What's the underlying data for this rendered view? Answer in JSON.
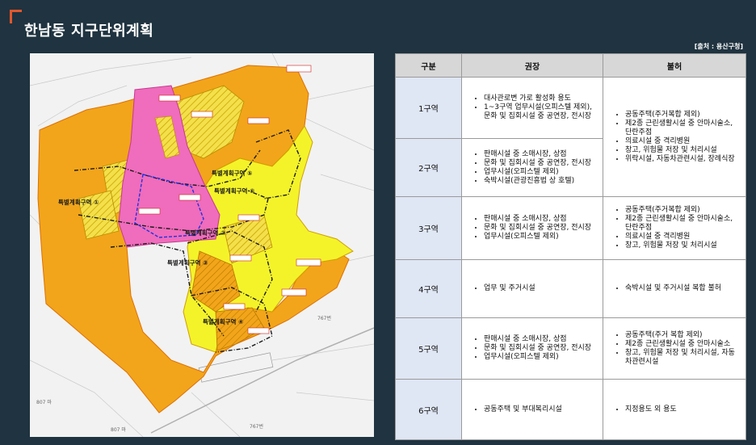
{
  "header": {
    "title": "한남동 지구단위계획",
    "source": "[출처 : 용산구청]"
  },
  "map": {
    "district_labels": [
      "특별계획구역 ①",
      "특별계획구역 ②",
      "특별계획구역 ③",
      "특별계획구역 ④",
      "특별계획구역 ⑤",
      "특별계획구역 ⑥"
    ],
    "road_labels": [
      "767번",
      "767번",
      "807 마",
      "807 마"
    ]
  },
  "table": {
    "headers": [
      "구분",
      "권장",
      "불허"
    ],
    "rows": [
      {
        "zone": "1구역",
        "recommended": [
          "대사관로변 가로 활성화 용도",
          "1~3구역 업무시설(오피스텔 제외), 문화 및 집회시설 중 공연장, 전시장"
        ]
      },
      {
        "zone": "2구역",
        "recommended": [
          "판매시설 중 소매시장, 상점",
          "문화 및 집회시설 중 공연장, 전시장",
          "업무시설(오피스텔 제외)",
          "숙박시설(관광진흥법 상 호텔)"
        ]
      },
      {
        "zone": "3구역",
        "recommended": [
          "판매시설 중 소매시장, 상점",
          "문화 및 집회시설 중 공연장, 전시장",
          "업무시설(오피스텔 제외)"
        ],
        "prohibited": [
          "공동주택(주거복합 제외)",
          "제2종 근린생활시설 중 안마시술소, 단란주점",
          "의료시설 중 격리병원",
          "창고, 위험물 저장 및 처리시설"
        ]
      },
      {
        "zone": "4구역",
        "recommended": [
          "업무 및 주거시설"
        ],
        "prohibited": [
          "숙박시설 및 주거시설 복합 불허"
        ]
      },
      {
        "zone": "5구역",
        "recommended": [
          "판매시설 중 소매시장, 상점",
          "문화 및 집회시설 중 공연장, 전시장",
          "업무시설(오피스텔 제외)"
        ],
        "prohibited": [
          "공동주택(주거 복합 제외)",
          "제2종 근린생활시설 중 안마시술소",
          "창고, 위험물 저장 및 처리시설, 자동차관련시설"
        ]
      },
      {
        "zone": "6구역",
        "recommended": [
          "공동주택 및 부대복리시설"
        ],
        "prohibited": [
          "지정용도 외 용도"
        ]
      }
    ],
    "prohibited_1_2": [
      "공동주택(주거복합 제외)",
      "제2종 근린생활시설 중 안마시술소, 단란주점",
      "의료시설 중 격리병원",
      "창고, 위험물 저장 및 처리시설",
      "위락시설, 자동차관련시설, 장례식장"
    ]
  }
}
